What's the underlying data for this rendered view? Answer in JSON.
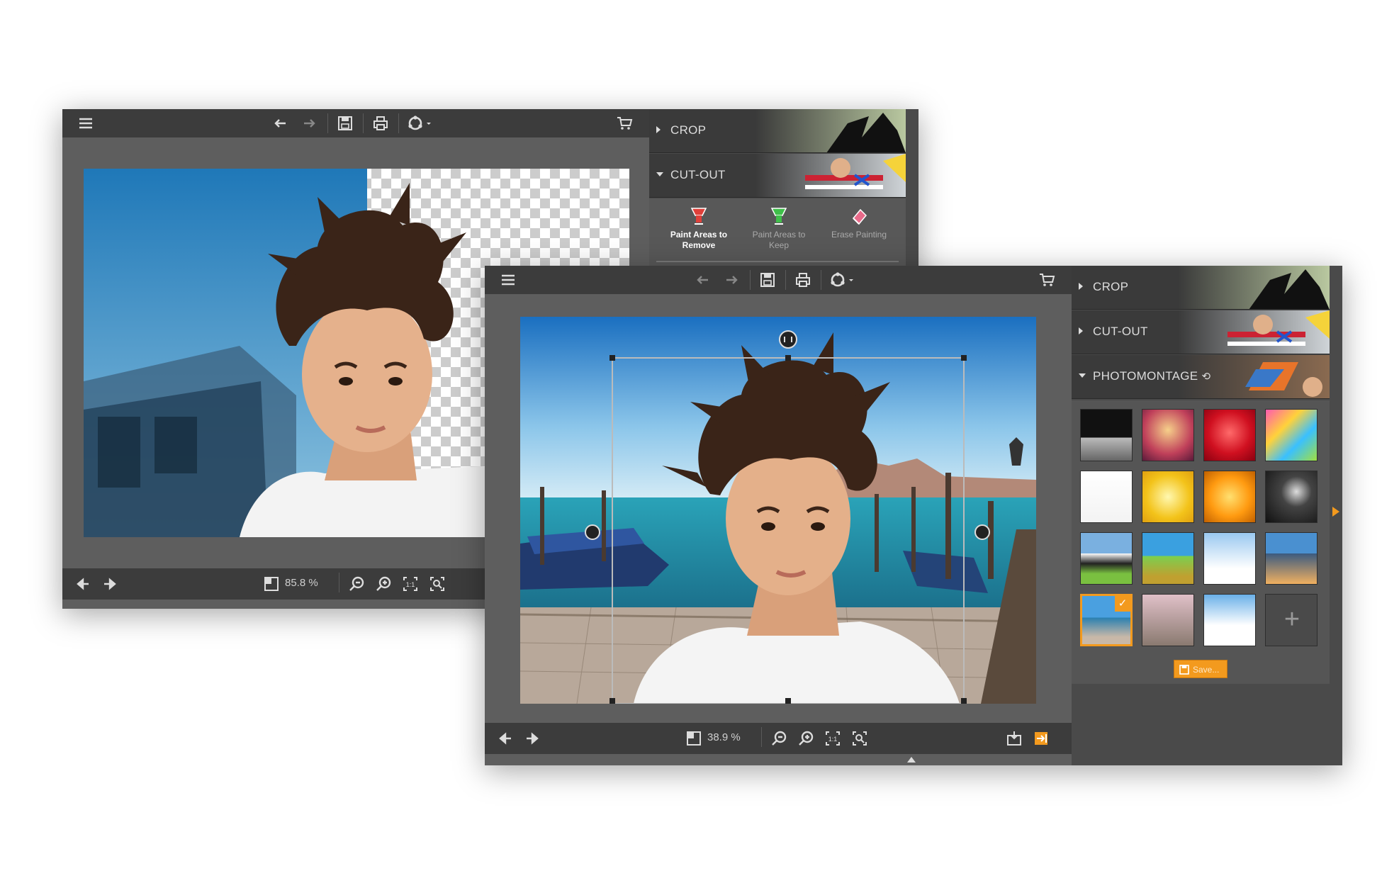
{
  "back_window": {
    "zoom": "85.8 %",
    "sections": [
      {
        "label": "CROP",
        "expanded": false
      },
      {
        "label": "CUT-OUT",
        "expanded": true
      }
    ],
    "cutout_tools": [
      {
        "label": "Paint Areas to Remove",
        "icon": "red-brush-icon",
        "active": true
      },
      {
        "label": "Paint Areas to Keep",
        "icon": "green-brush-icon",
        "active": false
      },
      {
        "label": "Erase Painting",
        "icon": "eraser-icon",
        "active": false
      }
    ]
  },
  "front_window": {
    "zoom": "38.9 %",
    "sections": [
      {
        "label": "CROP",
        "expanded": false
      },
      {
        "label": "CUT-OUT",
        "expanded": false
      },
      {
        "label": "PHOTOMONTAGE",
        "expanded": true
      }
    ],
    "save_button": "Save...",
    "backgrounds": [
      "moon-landscape",
      "heart-sunset",
      "red-heart",
      "comic-speech",
      "cartoon-dog",
      "golden-burst",
      "orange-sparkle",
      "dark-lights",
      "cow",
      "green-field",
      "snowman",
      "city-skyline",
      "venice-canal",
      "blossom-path",
      "snowy-trees",
      "add"
    ],
    "selected_background": "venice-canal"
  },
  "colors": {
    "accent": "#f39a1e",
    "toolbar": "#3c3c3c",
    "workspace": "#5e5e5e"
  }
}
